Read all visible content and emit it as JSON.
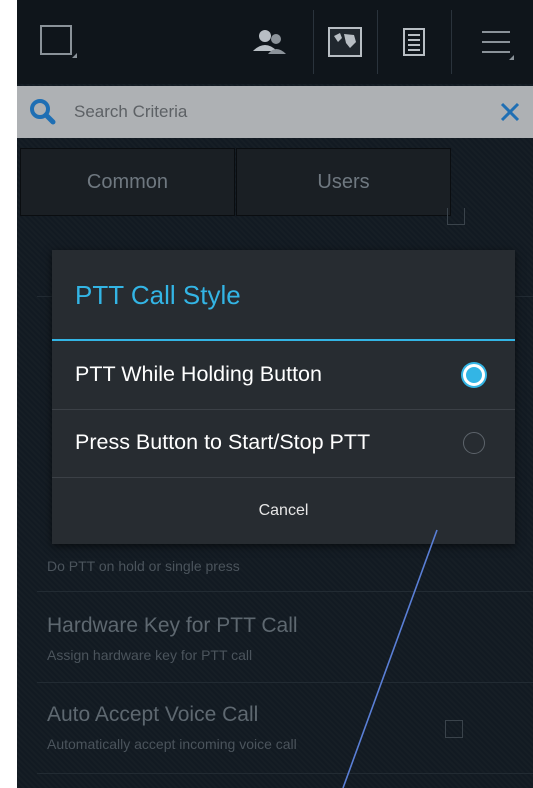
{
  "search": {
    "placeholder": "Search Criteria"
  },
  "tabs": [
    {
      "label": "Common"
    },
    {
      "label": "Users"
    }
  ],
  "settings": {
    "ptt_mode_subtitle": "Do PTT on hold or single press",
    "hardware_key": {
      "title": "Hardware Key for PTT Call",
      "subtitle": "Assign hardware key for PTT call"
    },
    "auto_accept": {
      "title": "Auto Accept Voice Call",
      "subtitle": "Automatically accept incoming voice call"
    }
  },
  "dialog": {
    "title": "PTT Call Style",
    "options": [
      {
        "label": "PTT While Holding Button",
        "selected": true
      },
      {
        "label": "Press Button to Start/Stop PTT",
        "selected": false
      }
    ],
    "cancel_label": "Cancel"
  },
  "colors": {
    "accent": "#33b5e5",
    "search_icon": "#1f6fb4"
  },
  "icons": [
    "window-icon",
    "contacts-icon",
    "map-icon",
    "list-icon",
    "menu-icon",
    "search-icon",
    "close-icon"
  ]
}
